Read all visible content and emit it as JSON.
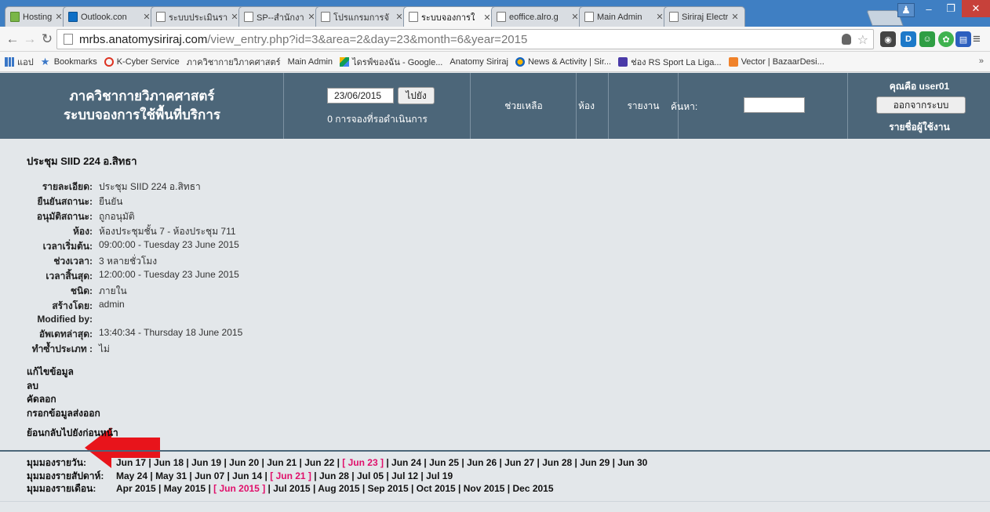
{
  "browser": {
    "tabs": [
      {
        "label": "HostingLotu",
        "icon": "tab-favicon"
      },
      {
        "label": "Outlook.con",
        "icon": "outlook-icon"
      },
      {
        "label": "ระบบประเมินรา",
        "icon": "page-icon"
      },
      {
        "label": "SP--สำนักงาน",
        "icon": "page-icon"
      },
      {
        "label": "โปรแกรมการจั",
        "icon": "page-icon"
      },
      {
        "label": "ระบบจองการใ",
        "icon": "page-icon",
        "active": true
      },
      {
        "label": "eoffice.alro.g",
        "icon": "page-icon"
      },
      {
        "label": "Main Admin",
        "icon": "page-icon"
      },
      {
        "label": "Siriraj Electro",
        "icon": "page-icon"
      }
    ],
    "url_host": "mrbs.anatomysiriraj.com",
    "url_path": "/view_entry.php?id=3&area=2&day=23&month=6&year=2015",
    "bookmarks": [
      {
        "label": "แอป",
        "icon": "apps-icon"
      },
      {
        "label": "Bookmarks",
        "icon": "star-icon"
      },
      {
        "label": "K-Cyber Service",
        "icon": "kcyber-icon"
      },
      {
        "label": "ภาควิชากายวิภาคศาสตร์",
        "icon": "page-icon"
      },
      {
        "label": "Main Admin",
        "icon": "page-icon"
      },
      {
        "label": "ไดรฟ์ของฉัน - Google...",
        "icon": "drive-icon"
      },
      {
        "label": "Anatomy Siriraj",
        "icon": "page-icon"
      },
      {
        "label": "News & Activity | Sir...",
        "icon": "news-icon"
      },
      {
        "label": "ช่อง RS Sport La Liga...",
        "icon": "tv-icon"
      },
      {
        "label": "Vector | BazaarDesi...",
        "icon": "vector-icon"
      }
    ],
    "bookmarks_more": "»"
  },
  "header": {
    "title_line1": "ภาควิชากายวิภาคศาสตร์",
    "title_line2": "ระบบจองการใช้พื้นที่บริการ",
    "date_value": "23/06/2015",
    "go_label": "ไปยัง",
    "pending_text": "0 การจองที่รอดำเนินการ",
    "help_label": "ช่วยเหลือ",
    "rooms_label": "ห้อง",
    "report_label": "รายงาน",
    "search_label": "ค้นหา:",
    "user_text": "คุณคือ user01",
    "logout_label": "ออกจากระบบ",
    "userlist_label": "รายชื่อผู้ใช้งาน"
  },
  "entry": {
    "title": "ประชุม SIID 224 อ.สิทธา",
    "fields": [
      {
        "key": "รายละเอียด:",
        "value": "ประชุม SIID 224 อ.สิทธา"
      },
      {
        "key": "ยืนยันสถานะ:",
        "value": "ยืนยัน"
      },
      {
        "key": "อนุมัติสถานะ:",
        "value": "ถูกอนุมัติ"
      },
      {
        "key": "ห้อง:",
        "value": "ห้องประชุมชั้น 7 - ห้องประชุม 711"
      },
      {
        "key": "เวลาเริ่มต้น:",
        "value": "09:00:00 - Tuesday 23 June 2015"
      },
      {
        "key": "ช่วงเวลา:",
        "value": "3 หลายชั่วโมง"
      },
      {
        "key": "เวลาสิ้นสุด:",
        "value": "12:00:00 - Tuesday 23 June 2015"
      },
      {
        "key": "ชนิด:",
        "value": "ภายใน"
      },
      {
        "key": "สร้างโดย:",
        "value": "admin"
      },
      {
        "key": "Modified by:",
        "value": ""
      },
      {
        "key": "อัพเดทล่าสุด:",
        "value": "13:40:34 - Thursday 18 June 2015"
      },
      {
        "key": "ทำซ้ำประเภท :",
        "value": "ไม่"
      }
    ],
    "actions": [
      "แก้ไขข้อมูล",
      "ลบ",
      "คัดลอก",
      "กรอกข้อมูลส่งออก"
    ],
    "back_label": "ย้อนกลับไปยังก่อนหน้า"
  },
  "views": {
    "day": {
      "label": "มุมมองรายวัน:",
      "items": [
        "Jun 17",
        "Jun 18",
        "Jun 19",
        "Jun 20",
        "Jun 21",
        "Jun 22",
        "Jun 23",
        "Jun 24",
        "Jun 25",
        "Jun 26",
        "Jun 27",
        "Jun 28",
        "Jun 29",
        "Jun 30"
      ],
      "current": "Jun 23"
    },
    "week": {
      "label": "มุมมองรายสัปดาห์:",
      "items": [
        "May 24",
        "May 31",
        "Jun 07",
        "Jun 14",
        "Jun 21",
        "Jun 28",
        "Jul 05",
        "Jul 12",
        "Jul 19"
      ],
      "current": "Jun 21"
    },
    "month": {
      "label": "มุมมองรายเดือน:",
      "items": [
        "Apr 2015",
        "May 2015",
        "Jun 2015",
        "Jul 2015",
        "Aug 2015",
        "Sep 2015",
        "Oct 2015",
        "Nov 2015",
        "Dec 2015"
      ],
      "current": "Jun 2015"
    }
  },
  "colors": {
    "header_bg": "#4c6679",
    "page_bg": "#e3e7ea",
    "current_link": "#e0106b",
    "annotation_arrow": "#e8141b"
  }
}
